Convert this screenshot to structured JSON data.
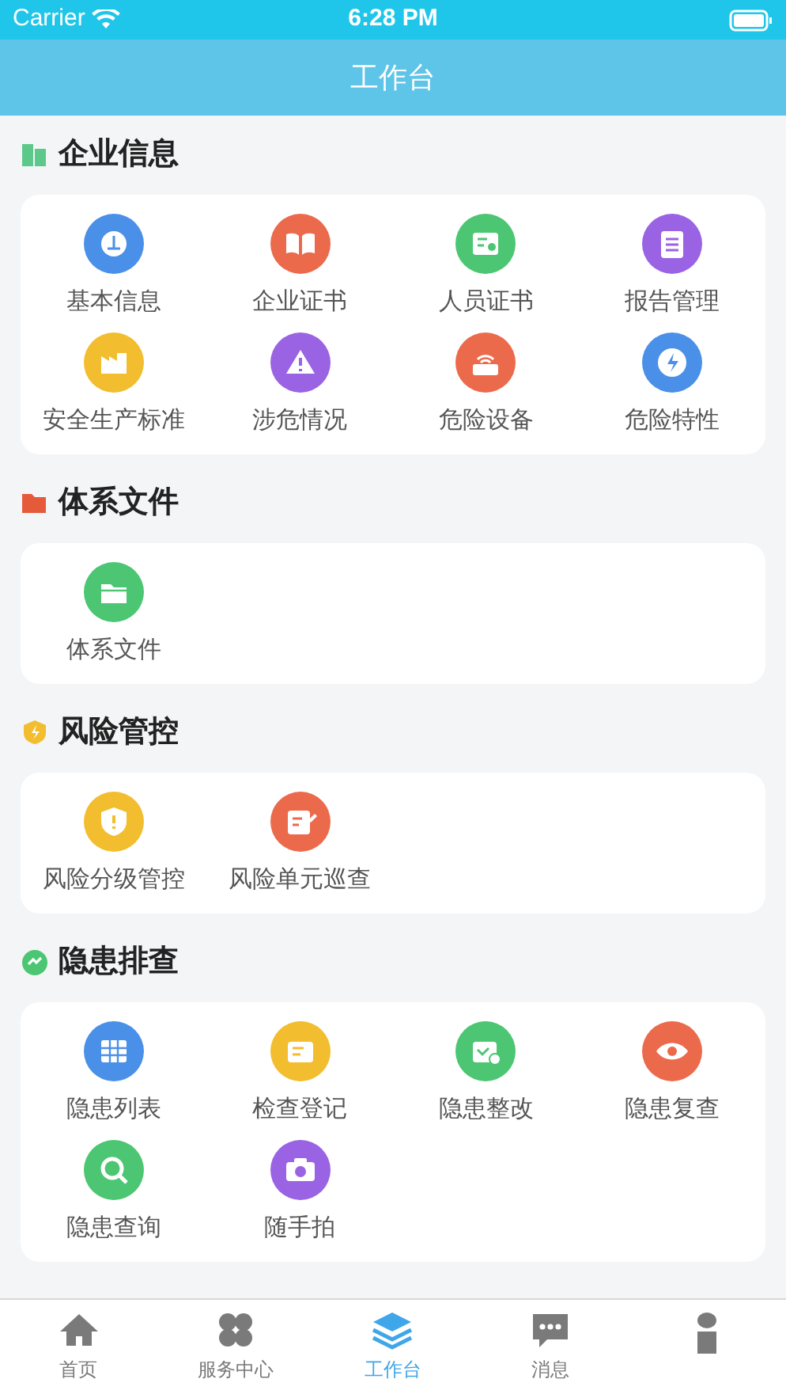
{
  "status_bar": {
    "carrier": "Carrier",
    "time": "6:28 PM"
  },
  "nav_bar": {
    "title": "工作台"
  },
  "sections": [
    {
      "title": "企业信息",
      "color": "#5cc98a",
      "items": [
        {
          "label": "基本信息",
          "color": "#4a90e8"
        },
        {
          "label": "企业证书",
          "color": "#ec6a4c"
        },
        {
          "label": "人员证书",
          "color": "#4cc672"
        },
        {
          "label": "报告管理",
          "color": "#9a63e4"
        },
        {
          "label": "安全生产标准",
          "color": "#f2bd2e"
        },
        {
          "label": "涉危情况",
          "color": "#9a63e4"
        },
        {
          "label": "危险设备",
          "color": "#ec6a4c"
        },
        {
          "label": "危险特性",
          "color": "#4a90e8"
        }
      ]
    },
    {
      "title": "体系文件",
      "color": "#e65a3c",
      "items": [
        {
          "label": "体系文件",
          "color": "#4cc672"
        }
      ]
    },
    {
      "title": "风险管控",
      "color": "#f2bd2e",
      "items": [
        {
          "label": "风险分级管控",
          "color": "#f2bd2e"
        },
        {
          "label": "风险单元巡查",
          "color": "#ec6a4c"
        }
      ]
    },
    {
      "title": "隐患排查",
      "color": "#4cc672",
      "items": [
        {
          "label": "隐患列表",
          "color": "#4a90e8"
        },
        {
          "label": "检查登记",
          "color": "#f2bd2e"
        },
        {
          "label": "隐患整改",
          "color": "#4cc672"
        },
        {
          "label": "隐患复查",
          "color": "#ec6a4c"
        },
        {
          "label": "隐患查询",
          "color": "#4cc672"
        },
        {
          "label": "随手拍",
          "color": "#9a63e4"
        }
      ]
    }
  ],
  "tab_bar": [
    {
      "label": "首页",
      "selected": false
    },
    {
      "label": "服务中心",
      "selected": false
    },
    {
      "label": "工作台",
      "selected": true
    },
    {
      "label": "消息",
      "selected": false
    },
    {
      "selected": false
    }
  ]
}
